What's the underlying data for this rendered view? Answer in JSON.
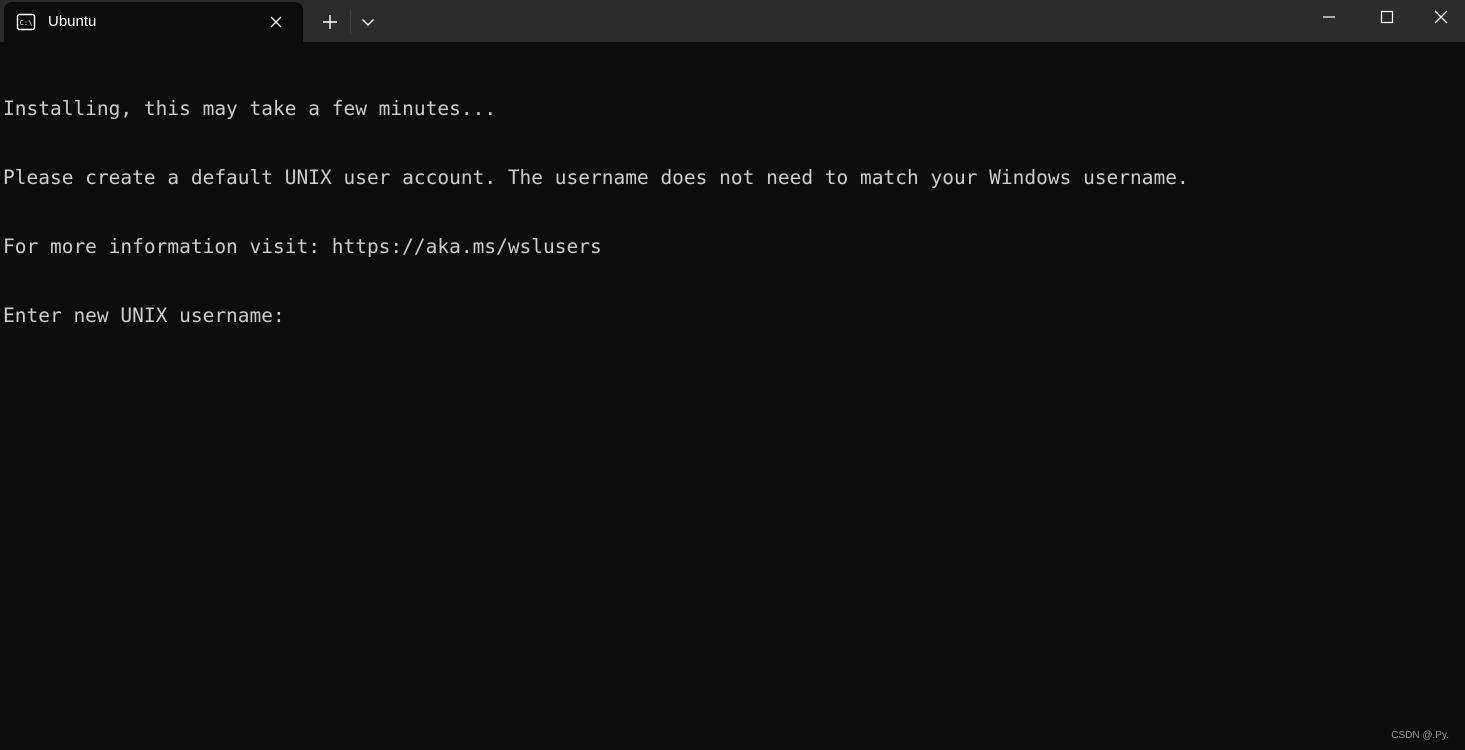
{
  "window": {
    "tab_title": "Ubuntu",
    "tab_icon": "terminal-icon",
    "new_tab_icon": "plus-icon",
    "dropdown_icon": "chevron-down-icon",
    "minimize_icon": "minimize-icon",
    "maximize_icon": "maximize-icon",
    "close_icon": "close-icon"
  },
  "terminal": {
    "lines": [
      "Installing, this may take a few minutes...",
      "Please create a default UNIX user account. The username does not need to match your Windows username.",
      "For more information visit: https://aka.ms/wslusers",
      "Enter new UNIX username: "
    ]
  },
  "watermark": "CSDN @.Py.",
  "colors": {
    "background": "#0c0c0c",
    "titlebar": "#2b2b2b",
    "text": "#cccccc"
  }
}
